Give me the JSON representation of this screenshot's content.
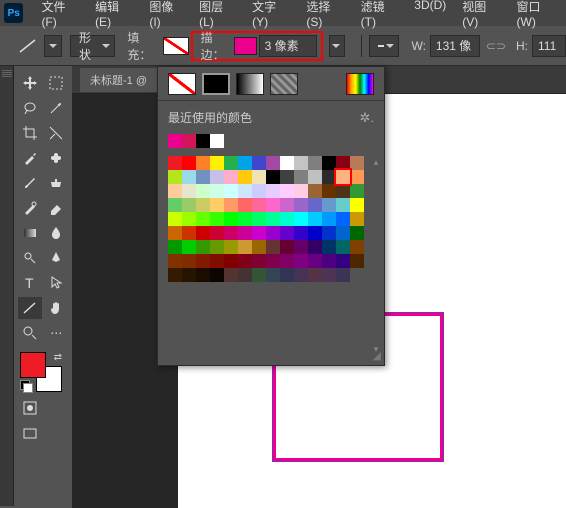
{
  "menu": {
    "items": [
      "文件(F)",
      "编辑(E)",
      "图像(I)",
      "图层(L)",
      "文字(Y)",
      "选择(S)",
      "滤镜(T)",
      "3D(D)",
      "视图(V)",
      "窗口(W)"
    ]
  },
  "optbar": {
    "shape_dd": "形状",
    "fill_label": "填充：",
    "stroke_label": "描边：",
    "stroke_width": "3 像素",
    "w_label": "W:",
    "w_val": "131 像",
    "h_label": "H:",
    "h_val": "111"
  },
  "tab": {
    "title": "未标题-1 @"
  },
  "panel": {
    "recent_label": "最近使用的颜色"
  },
  "recent_colors": [
    "#ec008c",
    "#d4145a",
    "#000000",
    "#ffffff"
  ],
  "grid_colors": [
    "#ed1c24",
    "#ff0000",
    "#ff7f27",
    "#fff200",
    "#22b14c",
    "#00a2e8",
    "#3f48cc",
    "#a349a4",
    "#ffffff",
    "#c3c3c3",
    "#7f7f7f",
    "#000000",
    "#880015",
    "#b97a57",
    "#b5e61d",
    "#99d9ea",
    "#7092be",
    "#c8bfe7",
    "#ffaec9",
    "#ffc90e",
    "#efe4b0",
    "#000000",
    "#404040",
    "#808080",
    "#c0c0c0",
    "#2b2b2b",
    "#ffb380",
    "#ff9955",
    "#ffcc99",
    "#e6e6cc",
    "#ccffcc",
    "#ccffe6",
    "#ccffff",
    "#cce6ff",
    "#ccccff",
    "#e6ccff",
    "#ffccff",
    "#ffcce6",
    "#996633",
    "#663300",
    "#4d3319",
    "#339933",
    "#66cc66",
    "#99cc66",
    "#cccc66",
    "#ffcc66",
    "#ff9966",
    "#ff6666",
    "#ff6699",
    "#ff66cc",
    "#cc66cc",
    "#9966cc",
    "#6666cc",
    "#6699cc",
    "#66cccc",
    "#ffff00",
    "#ccff00",
    "#99ff00",
    "#66ff00",
    "#33ff00",
    "#00ff00",
    "#00ff33",
    "#00ff66",
    "#00ff99",
    "#00ffcc",
    "#00ffff",
    "#00ccff",
    "#0099ff",
    "#0066ff",
    "#cc9900",
    "#cc6600",
    "#cc3300",
    "#cc0000",
    "#cc0033",
    "#cc0066",
    "#cc0099",
    "#cc00cc",
    "#9900cc",
    "#6600cc",
    "#3300cc",
    "#0000cc",
    "#0033cc",
    "#0066cc",
    "#006600",
    "#009900",
    "#00cc00",
    "#339900",
    "#669900",
    "#999900",
    "#cc9933",
    "#996600",
    "#663333",
    "#660033",
    "#660066",
    "#330066",
    "#003366",
    "#006666",
    "#804000",
    "#803300",
    "#802b00",
    "#801a00",
    "#800d00",
    "#800000",
    "#80001a",
    "#800033",
    "#80004d",
    "#800066",
    "#800080",
    "#660080",
    "#4d0080",
    "#330080",
    "#4d2600",
    "#331a00",
    "#261300",
    "#1a0d00",
    "#0d0600",
    "#553333",
    "#443333",
    "#335533",
    "#334455",
    "#333355",
    "#443355",
    "#553344",
    "#4d3355",
    "#3d3355"
  ],
  "selected_grid_index": 26
}
